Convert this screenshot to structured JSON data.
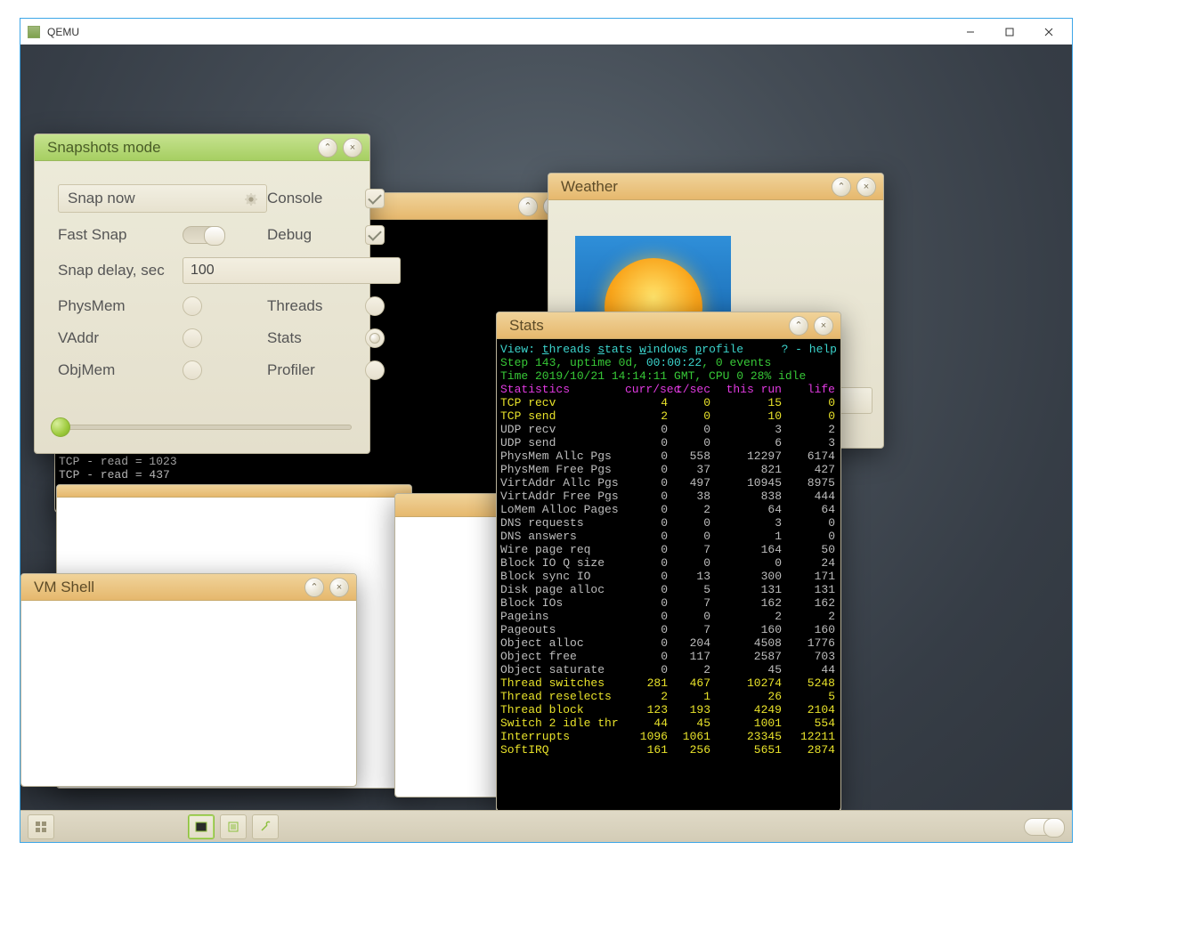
{
  "host": {
    "title": "QEMU"
  },
  "windows": {
    "snapshots": {
      "title": "Snapshots mode",
      "snap_now": "Snap now",
      "fast_snap": "Fast Snap",
      "delay_label": "Snap delay, sec",
      "delay_value": "100",
      "console": "Console",
      "debug": "Debug",
      "physmem": "PhysMem",
      "vaddr": "VAddr",
      "objmem": "ObjMem",
      "threads": "Threads",
      "stats": "Stats",
      "profiler": "Profiler"
    },
    "weather": {
      "title": "Weather"
    },
    "vmshell": {
      "title": "VM Shell"
    },
    "stats": {
      "title": "Stats",
      "view_line": {
        "prefix": "View: ",
        "threads": "threads ",
        "stats": "stats ",
        "windows": "windows ",
        "profile": "profile",
        "help": "? - help"
      },
      "step_line": {
        "a": "Step 143, uptime 0d, ",
        "b": "00:00:22",
        "c": ", 0 events"
      },
      "time_line": "Time 2019/10/21 14:14:11 GMT, CPU 0 28% idle",
      "hdr": {
        "label": "Statistics",
        "a": "curr/sec",
        "b": "t/sec",
        "c": "this run",
        "d": "life"
      },
      "rows": [
        {
          "label": "TCP recv",
          "a": "4",
          "b": "0",
          "c": "15",
          "d": "0",
          "cls": "yel"
        },
        {
          "label": "TCP send",
          "a": "2",
          "b": "0",
          "c": "10",
          "d": "0",
          "cls": "yel"
        },
        {
          "label": "UDP recv",
          "a": "0",
          "b": "0",
          "c": "3",
          "d": "2",
          "cls": "gray"
        },
        {
          "label": "UDP send",
          "a": "0",
          "b": "0",
          "c": "6",
          "d": "3",
          "cls": "gray"
        },
        {
          "label": "PhysMem Allc Pgs",
          "a": "0",
          "b": "558",
          "c": "12297",
          "d": "6174",
          "cls": "gray"
        },
        {
          "label": "PhysMem Free Pgs",
          "a": "0",
          "b": "37",
          "c": "821",
          "d": "427",
          "cls": "gray"
        },
        {
          "label": "VirtAddr Allc Pgs",
          "a": "0",
          "b": "497",
          "c": "10945",
          "d": "8975",
          "cls": "gray"
        },
        {
          "label": "VirtAddr Free Pgs",
          "a": "0",
          "b": "38",
          "c": "838",
          "d": "444",
          "cls": "gray"
        },
        {
          "label": "LoMem Alloc Pages",
          "a": "0",
          "b": "2",
          "c": "64",
          "d": "64",
          "cls": "gray"
        },
        {
          "label": "DNS requests",
          "a": "0",
          "b": "0",
          "c": "3",
          "d": "0",
          "cls": "gray"
        },
        {
          "label": "DNS answers",
          "a": "0",
          "b": "0",
          "c": "1",
          "d": "0",
          "cls": "gray"
        },
        {
          "label": "Wire page req",
          "a": "0",
          "b": "7",
          "c": "164",
          "d": "50",
          "cls": "gray"
        },
        {
          "label": "Block IO Q size",
          "a": "0",
          "b": "0",
          "c": "0",
          "d": "24",
          "cls": "gray"
        },
        {
          "label": "Block sync IO",
          "a": "0",
          "b": "13",
          "c": "300",
          "d": "171",
          "cls": "gray"
        },
        {
          "label": "Disk page alloc",
          "a": "0",
          "b": "5",
          "c": "131",
          "d": "131",
          "cls": "gray"
        },
        {
          "label": "Block IOs",
          "a": "0",
          "b": "7",
          "c": "162",
          "d": "162",
          "cls": "gray"
        },
        {
          "label": "Pageins",
          "a": "0",
          "b": "0",
          "c": "2",
          "d": "2",
          "cls": "gray"
        },
        {
          "label": "Pageouts",
          "a": "0",
          "b": "7",
          "c": "160",
          "d": "160",
          "cls": "gray"
        },
        {
          "label": "Object alloc",
          "a": "0",
          "b": "204",
          "c": "4508",
          "d": "1776",
          "cls": "gray"
        },
        {
          "label": "Object free",
          "a": "0",
          "b": "117",
          "c": "2587",
          "d": "703",
          "cls": "gray"
        },
        {
          "label": "Object saturate",
          "a": "0",
          "b": "2",
          "c": "45",
          "d": "44",
          "cls": "gray"
        },
        {
          "label": "Thread switches",
          "a": "281",
          "b": "467",
          "c": "10274",
          "d": "5248",
          "cls": "yel"
        },
        {
          "label": "Thread reselects",
          "a": "2",
          "b": "1",
          "c": "26",
          "d": "5",
          "cls": "yel"
        },
        {
          "label": "Thread block",
          "a": "123",
          "b": "193",
          "c": "4249",
          "d": "2104",
          "cls": "yel"
        },
        {
          "label": "Switch 2 idle thr",
          "a": "44",
          "b": "45",
          "c": "1001",
          "d": "554",
          "cls": "yel"
        },
        {
          "label": "Interrupts",
          "a": "1096",
          "b": "1061",
          "c": "23345",
          "d": "12211",
          "cls": "yel"
        },
        {
          "label": "SoftIRQ",
          "a": "161",
          "b": "256",
          "c": "5651",
          "d": "2874",
          "cls": "yel"
        }
      ]
    },
    "console": {
      "lines": [
        "TCP - read = 1023",
        "TCP - read = 437"
      ]
    }
  }
}
